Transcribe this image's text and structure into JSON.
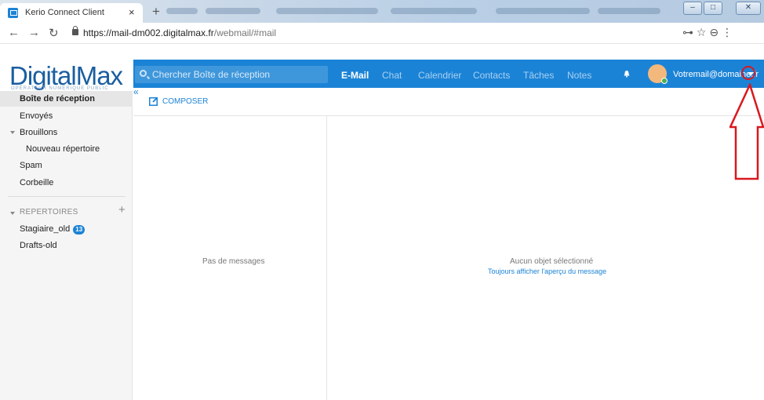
{
  "browser": {
    "tab_title": "Kerio Connect Client",
    "tab_close": "×",
    "new_tab": "+",
    "url_host": "https://mail-dm002.digitalmax.fr",
    "url_path": "/webmail/#mail",
    "controls": "⊶  ☆  ⊖  ⋮"
  },
  "app": {
    "logo": "DigitalMax",
    "logo_sub": "OPÉRATEUR NUMÉRIQUE PUBLIC",
    "search_placeholder": "Chercher Boîte de réception",
    "nav": [
      {
        "label": "E-Mail",
        "active": true
      },
      {
        "label": "Chat"
      },
      {
        "label": "Calendrier"
      },
      {
        "label": "Contacts"
      },
      {
        "label": "Tâches"
      },
      {
        "label": "Notes"
      }
    ],
    "user_email": "Votremail@domaine.fr"
  },
  "sidebar": {
    "collapse": "«",
    "folders": [
      {
        "label": "Boîte de réception"
      },
      {
        "label": "Envoyés"
      },
      {
        "label": "Brouillons"
      },
      {
        "label": "Nouveau répertoire"
      },
      {
        "label": "Spam"
      },
      {
        "label": "Corbeille"
      }
    ],
    "section_title": "REPERTOIRES",
    "section_add": "+",
    "shared": [
      {
        "label": "Stagiaire_old",
        "badge": "13"
      },
      {
        "label": "Drafts-old"
      }
    ]
  },
  "main": {
    "compose": "COMPOSER",
    "empty_list": "Pas de messages",
    "empty_preview": "Aucun objet sélectionné",
    "preview_link": "Toujours afficher l'aperçu du message"
  },
  "colors": {
    "accent": "#1b83d6",
    "annotation": "#d9181e"
  }
}
